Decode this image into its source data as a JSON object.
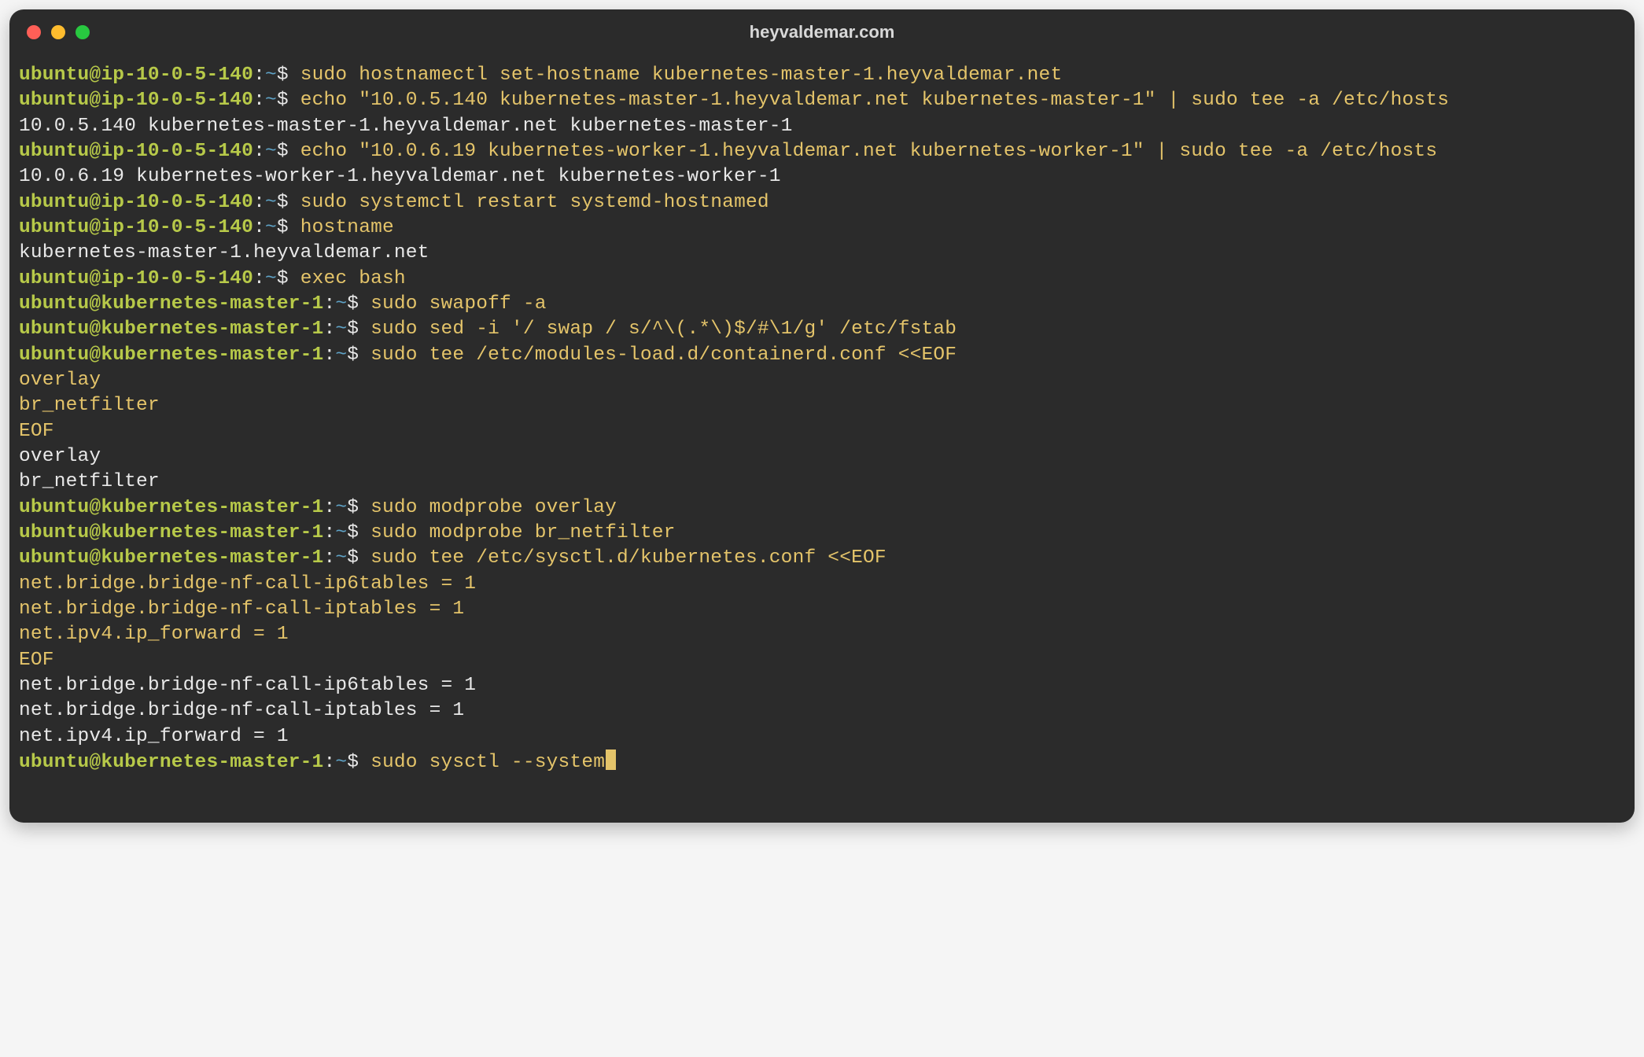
{
  "window": {
    "title": "heyvaldemar.com"
  },
  "colors": {
    "bg": "#2b2b2b",
    "user_host": "#b7c949",
    "path": "#5fa3c7",
    "cmd": "#e4c46a",
    "out": "#e8e8e8",
    "red": "#ff5f57",
    "yellow": "#febc2e",
    "green": "#28c840"
  },
  "prompts": {
    "ip": {
      "user_host": "ubuntu@ip-10-0-5-140",
      "colon": ":",
      "path": "~",
      "dollar": "$"
    },
    "kube": {
      "user_host": "ubuntu@kubernetes-master-1",
      "colon": ":",
      "path": "~",
      "dollar": "$"
    }
  },
  "lines": [
    {
      "type": "prompt",
      "p": "ip",
      "cmd": "sudo hostnamectl set-hostname kubernetes-master-1.heyvaldemar.net"
    },
    {
      "type": "prompt",
      "p": "ip",
      "cmd": "echo \"10.0.5.140 kubernetes-master-1.heyvaldemar.net kubernetes-master-1\" | sudo tee -a /etc/hosts"
    },
    {
      "type": "out",
      "text": "10.0.5.140 kubernetes-master-1.heyvaldemar.net kubernetes-master-1"
    },
    {
      "type": "prompt",
      "p": "ip",
      "cmd": "echo \"10.0.6.19 kubernetes-worker-1.heyvaldemar.net kubernetes-worker-1\" | sudo tee -a /etc/hosts"
    },
    {
      "type": "out",
      "text": "10.0.6.19 kubernetes-worker-1.heyvaldemar.net kubernetes-worker-1"
    },
    {
      "type": "prompt",
      "p": "ip",
      "cmd": "sudo systemctl restart systemd-hostnamed"
    },
    {
      "type": "prompt",
      "p": "ip",
      "cmd": "hostname"
    },
    {
      "type": "out",
      "text": "kubernetes-master-1.heyvaldemar.net"
    },
    {
      "type": "prompt",
      "p": "ip",
      "cmd": "exec bash"
    },
    {
      "type": "prompt",
      "p": "kube",
      "cmd": "sudo swapoff -a"
    },
    {
      "type": "prompt",
      "p": "kube",
      "cmd": "sudo sed -i '/ swap / s/^\\(.*\\)$/#\\1/g' /etc/fstab"
    },
    {
      "type": "prompt",
      "p": "kube",
      "cmd": "sudo tee /etc/modules-load.d/containerd.conf <<EOF"
    },
    {
      "type": "cmdcont",
      "text": "overlay"
    },
    {
      "type": "cmdcont",
      "text": "br_netfilter"
    },
    {
      "type": "cmdcont",
      "text": "EOF"
    },
    {
      "type": "out",
      "text": "overlay"
    },
    {
      "type": "out",
      "text": "br_netfilter"
    },
    {
      "type": "prompt",
      "p": "kube",
      "cmd": "sudo modprobe overlay"
    },
    {
      "type": "prompt",
      "p": "kube",
      "cmd": "sudo modprobe br_netfilter"
    },
    {
      "type": "prompt",
      "p": "kube",
      "cmd": "sudo tee /etc/sysctl.d/kubernetes.conf <<EOF"
    },
    {
      "type": "cmdcont",
      "text": "net.bridge.bridge-nf-call-ip6tables = 1"
    },
    {
      "type": "cmdcont",
      "text": "net.bridge.bridge-nf-call-iptables = 1"
    },
    {
      "type": "cmdcont",
      "text": "net.ipv4.ip_forward = 1"
    },
    {
      "type": "cmdcont",
      "text": "EOF"
    },
    {
      "type": "out",
      "text": "net.bridge.bridge-nf-call-ip6tables = 1"
    },
    {
      "type": "out",
      "text": "net.bridge.bridge-nf-call-iptables = 1"
    },
    {
      "type": "out",
      "text": "net.ipv4.ip_forward = 1"
    },
    {
      "type": "prompt",
      "p": "kube",
      "cmd": "sudo sysctl --system",
      "cursor": true
    }
  ]
}
